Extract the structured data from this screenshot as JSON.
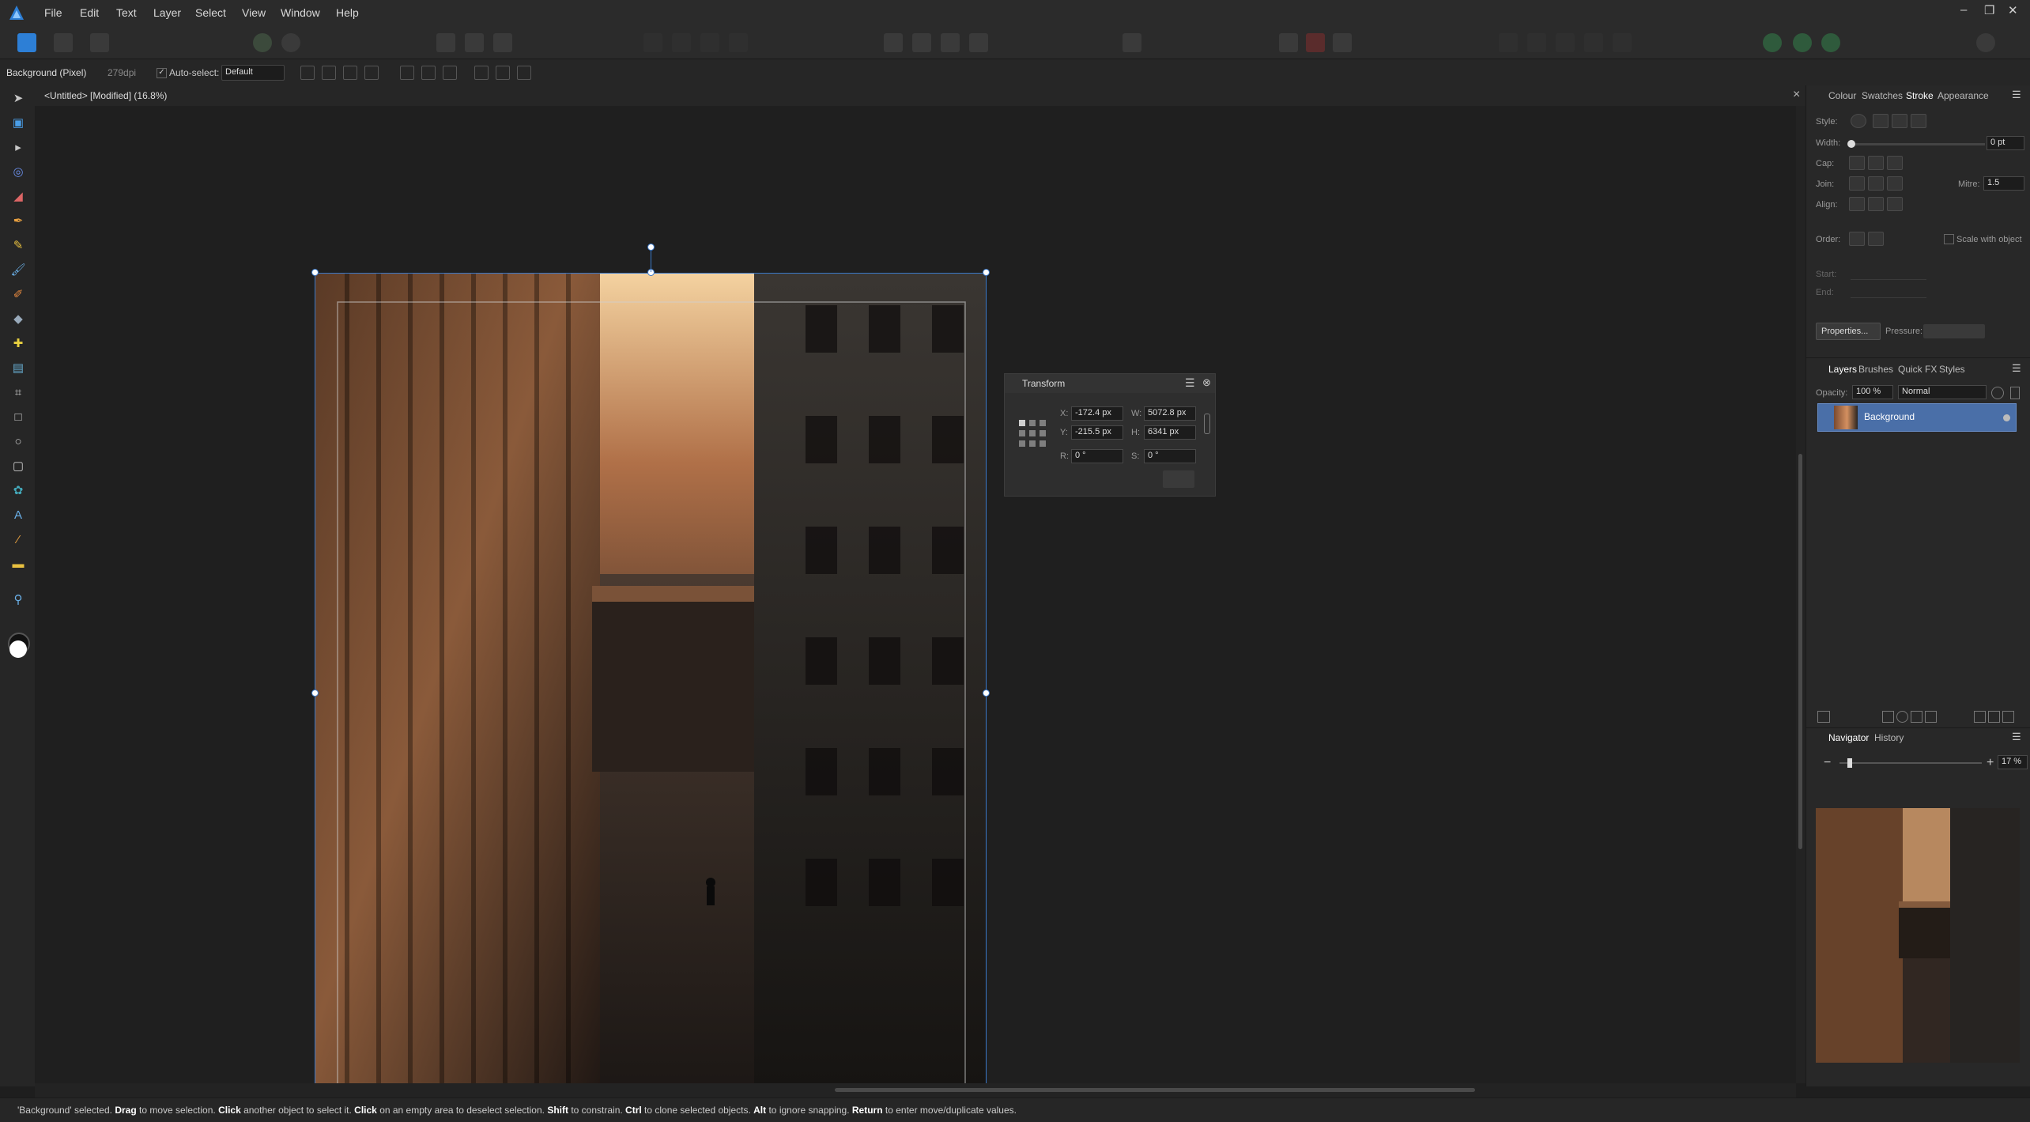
{
  "app": {
    "logo_icon": "affinity-photo-logo-icon",
    "accent": "#3a78c8"
  },
  "menu": {
    "items": [
      "File",
      "Edit",
      "Text",
      "Layer",
      "Select",
      "View",
      "Window",
      "Help"
    ]
  },
  "window_controls": {
    "minimize": "–",
    "restore": "❐",
    "close": "✕"
  },
  "context_bar": {
    "layer_info": "Background (Pixel)",
    "dpi": "279dpi",
    "autoselect_label": "Auto-select:",
    "autoselect_value": "Default"
  },
  "document": {
    "tab_title": "<Untitled> [Modified] (16.8%)",
    "close": "×"
  },
  "transform_panel": {
    "title": "Transform",
    "x_label": "X:",
    "x_value": "-172.4 px",
    "y_label": "Y:",
    "y_value": "-215.5 px",
    "w_label": "W:",
    "w_value": "5072.8 px",
    "h_label": "H:",
    "h_value": "6341 px",
    "r_label": "R:",
    "r_value": "0 °",
    "s_label": "S:",
    "s_value": "0 °"
  },
  "stroke_panel": {
    "tabs": [
      "Colour",
      "Swatches",
      "Stroke",
      "Appearance"
    ],
    "active_tab": "Stroke",
    "style_label": "Style:",
    "width_label": "Width:",
    "width_value": "0 pt",
    "cap_label": "Cap:",
    "join_label": "Join:",
    "mitre_label": "Mitre:",
    "mitre_value": "1.5",
    "align_label": "Align:",
    "order_label": "Order:",
    "scale_label": "Scale with object",
    "start_label": "Start:",
    "end_label": "End:",
    "properties_label": "Properties...",
    "pressure_label": "Pressure:"
  },
  "layers_panel": {
    "tabs": [
      "Layers",
      "Brushes",
      "Quick FX",
      "Styles"
    ],
    "opacity_label": "Opacity:",
    "opacity_value": "100 %",
    "blend_value": "Normal",
    "layer_name": "Background"
  },
  "navigator_panel": {
    "tabs": [
      "Navigator",
      "History"
    ],
    "zoom_value": "17 %",
    "minus": "−",
    "plus": "+"
  },
  "status": {
    "parts": [
      {
        "t": "'Background' selected. ",
        "b": false
      },
      {
        "t": "Drag",
        "b": true
      },
      {
        "t": " to move selection. ",
        "b": false
      },
      {
        "t": "Click",
        "b": true
      },
      {
        "t": " another object to select it. ",
        "b": false
      },
      {
        "t": "Click",
        "b": true
      },
      {
        "t": " on an empty area to deselect selection. ",
        "b": false
      },
      {
        "t": "Shift",
        "b": true
      },
      {
        "t": " to constrain. ",
        "b": false
      },
      {
        "t": "Ctrl",
        "b": true
      },
      {
        "t": " to clone selected objects. ",
        "b": false
      },
      {
        "t": "Alt",
        "b": true
      },
      {
        "t": " to ignore snapping. ",
        "b": false
      },
      {
        "t": "Return",
        "b": true
      },
      {
        "t": " to enter move/duplicate values.",
        "b": false
      }
    ]
  }
}
